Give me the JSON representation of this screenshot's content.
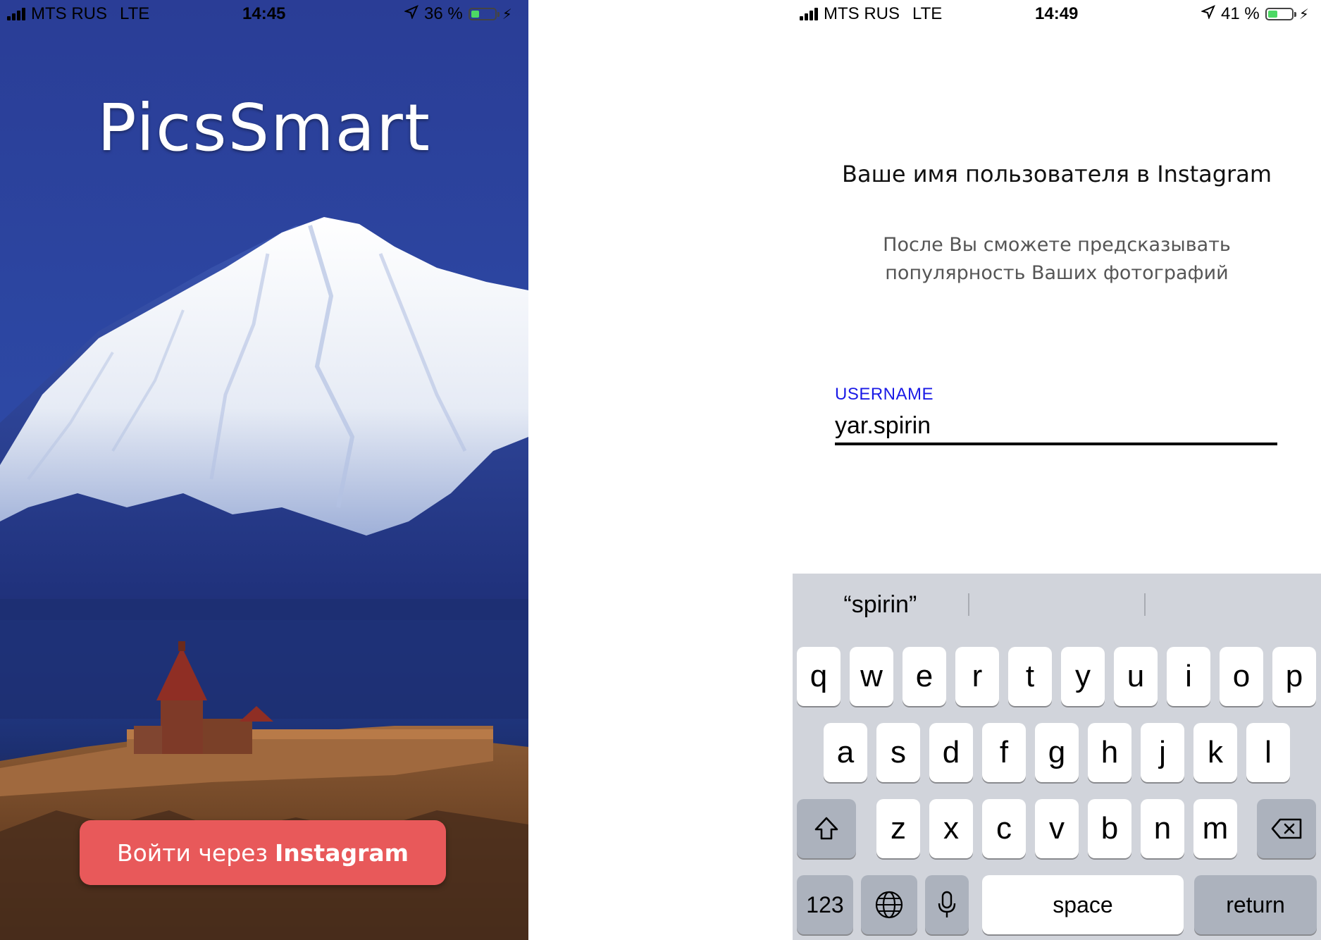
{
  "left_screen": {
    "status_bar": {
      "carrier": "MTS RUS",
      "network": "LTE",
      "time": "14:45",
      "battery_percent_text": "36 %",
      "battery_level": 0.36,
      "icons": [
        "signal-icon",
        "location-arrow-icon",
        "battery-icon",
        "charging-bolt-icon"
      ]
    },
    "app_title": "PicsSmart",
    "login_button": {
      "prefix": "Войти через",
      "brand": "Instagram"
    },
    "colors": {
      "button": "#e8595a",
      "sky": "#2c45a0"
    }
  },
  "right_screen": {
    "status_bar": {
      "carrier": "MTS RUS",
      "network": "LTE",
      "time": "14:49",
      "battery_percent_text": "41 %",
      "battery_level": 0.41,
      "icons": [
        "signal-icon",
        "location-arrow-icon",
        "battery-icon",
        "charging-bolt-icon"
      ]
    },
    "heading": "Ваше имя пользователя в Instagram",
    "subheading_line1": "После Вы сможете предсказывать",
    "subheading_line2": "популярность Ваших фотографий",
    "username_field": {
      "label": "USERNAME",
      "value": "yar.spirin"
    },
    "colors": {
      "label": "#1a1ae6",
      "keyboard_bg": "#d1d4db"
    },
    "keyboard": {
      "suggestions": [
        "“spirin”",
        "",
        ""
      ],
      "row1": [
        "q",
        "w",
        "e",
        "r",
        "t",
        "y",
        "u",
        "i",
        "o",
        "p"
      ],
      "row2": [
        "a",
        "s",
        "d",
        "f",
        "g",
        "h",
        "j",
        "k",
        "l"
      ],
      "row3": [
        "z",
        "x",
        "c",
        "v",
        "b",
        "n",
        "m"
      ],
      "numbers_key": "123",
      "space_key": "space",
      "return_key": "return",
      "icons": [
        "shift-icon",
        "backspace-icon",
        "globe-icon",
        "microphone-icon"
      ]
    }
  }
}
